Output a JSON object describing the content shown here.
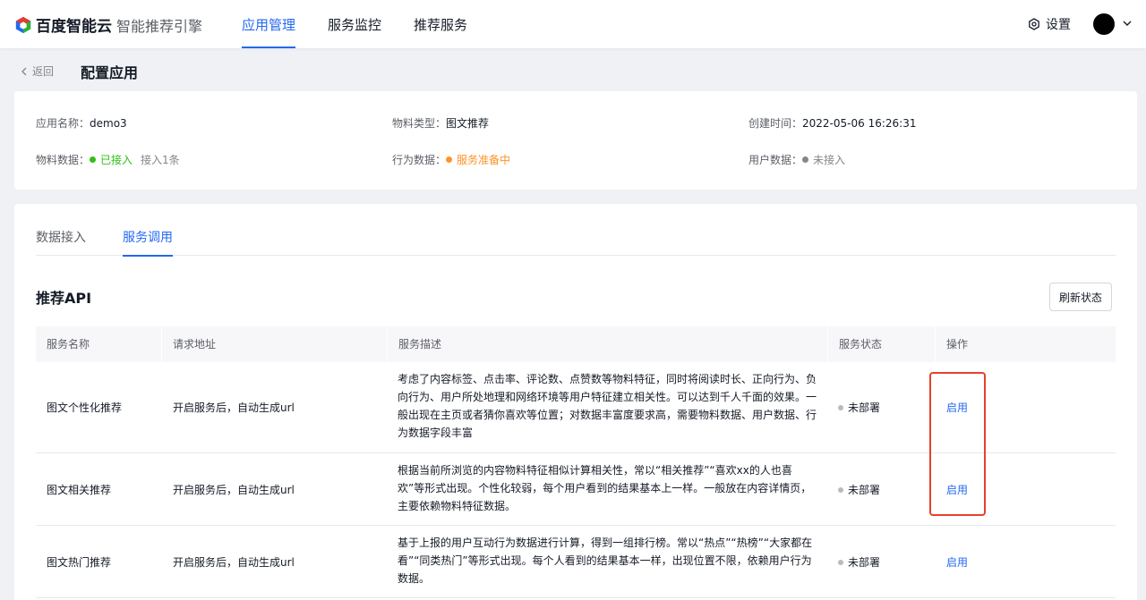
{
  "brand": {
    "logo_text": "百度智能云",
    "product": "智能推荐引擎"
  },
  "nav": {
    "items": [
      {
        "label": "应用管理",
        "active": true
      },
      {
        "label": "服务监控",
        "active": false
      },
      {
        "label": "推荐服务",
        "active": false
      }
    ],
    "settings_label": "设置"
  },
  "header": {
    "back_label": "返回",
    "title": "配置应用"
  },
  "info": {
    "app_name_label": "应用名称：",
    "app_name": "demo3",
    "material_type_label": "物料类型：",
    "material_type": "图文推荐",
    "created_label": "创建时间：",
    "created": "2022-05-06 16:26:31",
    "material_data_label": "物料数据：",
    "material_data_status": "已接入",
    "material_data_count": "接入1条",
    "behavior_data_label": "行为数据：",
    "behavior_data_status": "服务准备中",
    "user_data_label": "用户数据：",
    "user_data_status": "未接入"
  },
  "tabs": [
    {
      "label": "数据接入",
      "active": false
    },
    {
      "label": "服务调用",
      "active": true
    }
  ],
  "section": {
    "title": "推荐API",
    "refresh_label": "刷新状态"
  },
  "table": {
    "headers": [
      "服务名称",
      "请求地址",
      "服务描述",
      "服务状态",
      "操作"
    ],
    "rows": [
      {
        "name": "图文个性化推荐",
        "url": "开启服务后，自动生成url",
        "desc": "考虑了内容标签、点击率、评论数、点赞数等物料特征，同时将阅读时长、正向行为、负向行为、用户所处地理和网络环境等用户特征建立相关性。可以达到千人千面的效果。一般出现在主页或者猜你喜欢等位置；对数据丰富度要求高，需要物料数据、用户数据、行为数据字段丰富",
        "status": "未部署",
        "action": "启用"
      },
      {
        "name": "图文相关推荐",
        "url": "开启服务后，自动生成url",
        "desc": "根据当前所浏览的内容物料特征相似计算相关性，常以“相关推荐”“喜欢xx的人也喜欢”等形式出现。个性化较弱，每个用户看到的结果基本上一样。一般放在内容详情页，主要依赖物料特征数据。",
        "status": "未部署",
        "action": "启用"
      },
      {
        "name": "图文热门推荐",
        "url": "开启服务后，自动生成url",
        "desc": "基于上报的用户互动行为数据进行计算，得到一组排行榜。常以“热点”“热榜”“大家都在看”“同类热门”等形式出现。每个人看到的结果基本一样，出现位置不限，依赖用户行为数据。",
        "status": "未部署",
        "action": "启用"
      }
    ]
  },
  "colors": {
    "primary": "#2468f2",
    "success": "#30bf13",
    "warning": "#ff9326",
    "highlight": "#e8402b"
  }
}
